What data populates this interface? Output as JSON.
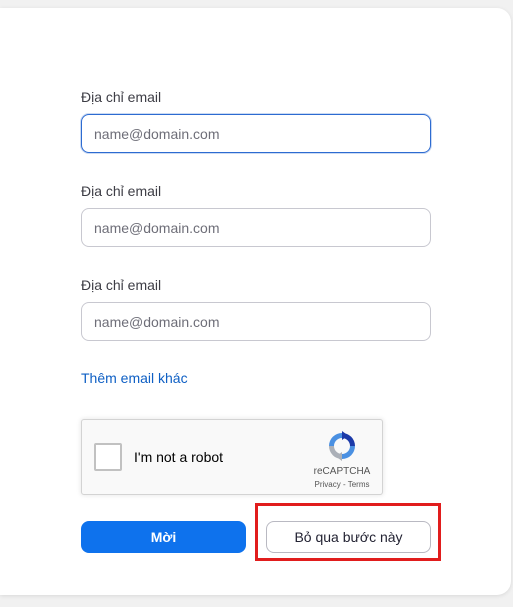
{
  "form": {
    "fields": [
      {
        "label": "Địa chỉ email",
        "placeholder": "name@domain.com",
        "value": ""
      },
      {
        "label": "Địa chỉ email",
        "placeholder": "name@domain.com",
        "value": ""
      },
      {
        "label": "Địa chỉ email",
        "placeholder": "name@domain.com",
        "value": ""
      }
    ],
    "add_email_link": "Thêm email khác"
  },
  "recaptcha": {
    "checkbox_label": "I'm not a robot",
    "brand": "reCAPTCHA",
    "links": "Privacy - Terms",
    "logo_icon": "recaptcha-logo-icon"
  },
  "actions": {
    "primary_label": "Mời",
    "secondary_label": "Bỏ qua bước này"
  },
  "colors": {
    "primary": "#0e72ed",
    "link": "#0e5fc4",
    "focus_border": "#2d6bd1",
    "highlight": "#e11d1d"
  }
}
